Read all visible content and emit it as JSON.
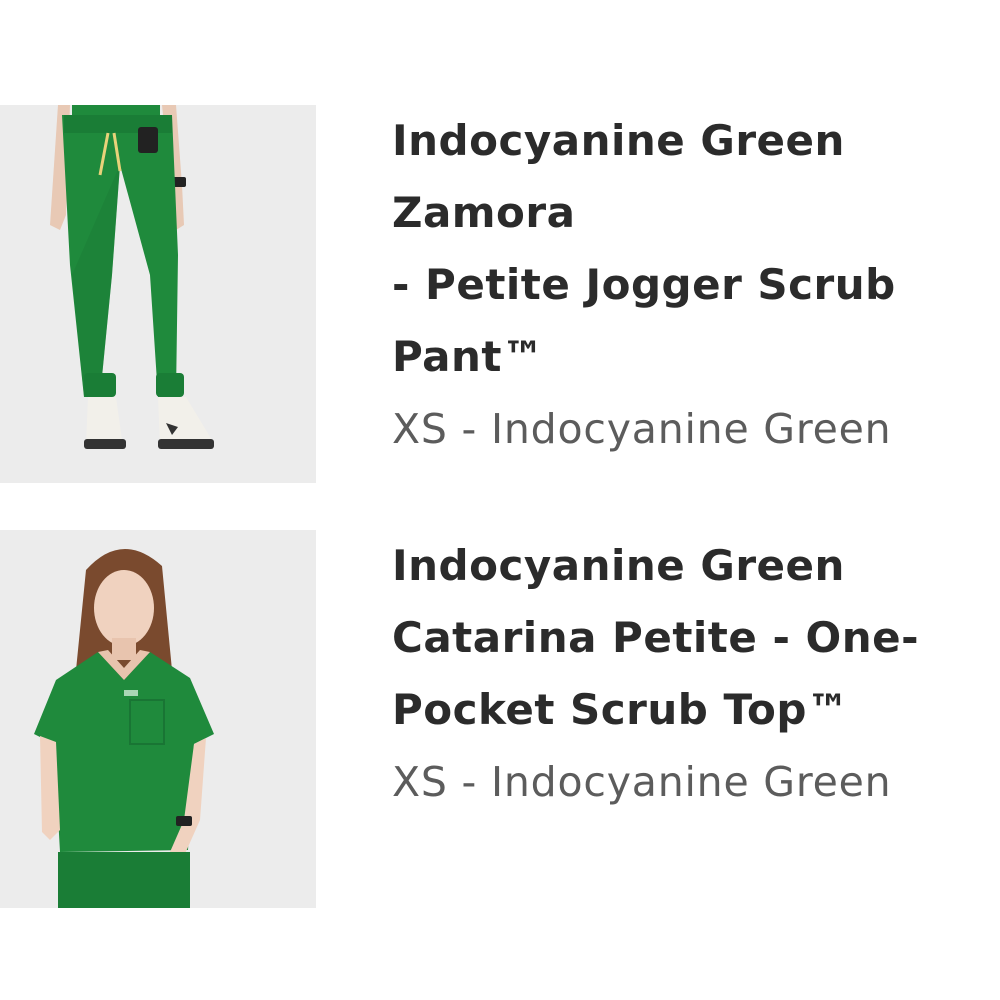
{
  "cart": {
    "items": [
      {
        "title": "Indocyanine Green Zamora\n- Petite Jogger Scrub\nPant™",
        "variant": "XS - Indocyanine Green",
        "image": "green-jogger-pants-photo"
      },
      {
        "title": "Indocyanine Green\nCatarina Petite - One-\nPocket Scrub Top™",
        "variant": "XS - Indocyanine Green",
        "image": "green-scrub-top-photo"
      }
    ]
  },
  "colors": {
    "scrub_green": "#1f8a3c",
    "title_text": "#2b2b2b",
    "variant_text": "#5c5c5c",
    "photo_bg": "#ececec"
  }
}
